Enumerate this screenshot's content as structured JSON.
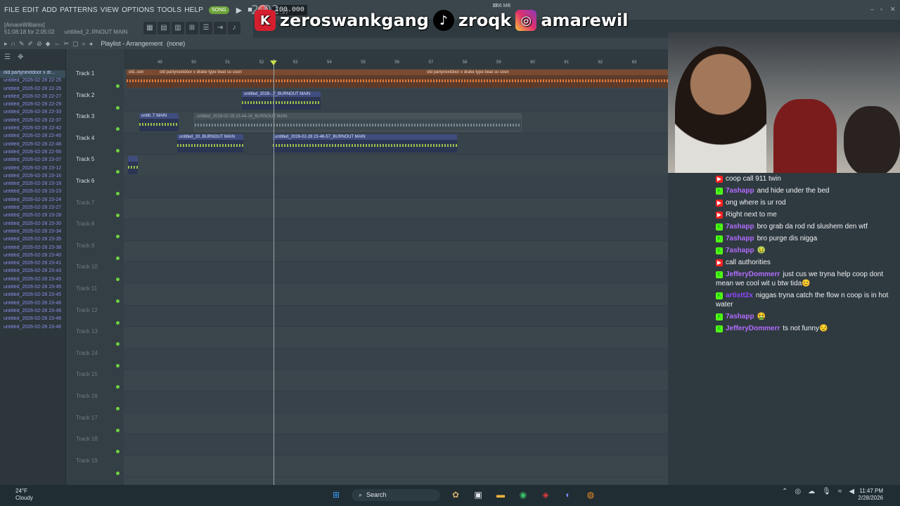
{
  "menubar": {
    "items": [
      "FILE",
      "EDIT",
      "ADD",
      "PATTERNS",
      "VIEW",
      "OPTIONS",
      "TOOLS",
      "HELP"
    ],
    "song_label": "SONG",
    "tempo": "100.000",
    "time_display": "2:02",
    "time_small": ":37",
    "memory": "666 MB",
    "pattern_num": "17",
    "project_name": "untitled_2..RNOUT MAIN",
    "hint_user": "[AmareWilliams]",
    "hint_time": "51:08:18 for 2:05:02"
  },
  "overlay": {
    "handle1": "zeroswankgang",
    "handle2": "zroqk",
    "handle3": "amarewil"
  },
  "playlist": {
    "title": "Playlist - Arrangement",
    "subtitle": "(none)"
  },
  "browser": {
    "items": [
      "old partynextdoor x dr...",
      "untitled_2026-02-28 22-25",
      "untitled_2026-02-28 22-26",
      "untitled_2026-02-28 22-27",
      "untitled_2026-02-28 22-29",
      "untitled_2026-02-28 22-33",
      "untitled_2026-02-28 22-37",
      "untitled_2026-02-28 22-42",
      "untitled_2026-02-28 22-45",
      "untitled_2026-02-28 22-48",
      "untitled_2026-02-28 22-56",
      "untitled_2026-02-28 23-07",
      "untitled_2026-02-28 23-12",
      "untitled_2026-02-28 23-16",
      "untitled_2026-02-28 23-18",
      "untitled_2026-02-28 23-23",
      "untitled_2026-02-28 23-24",
      "untitled_2026-02-28 23-27",
      "untitled_2026-02-28 23-28",
      "untitled_2026-02-28 23-30",
      "untitled_2026-02-28 23-34",
      "untitled_2026-02-28 23-35",
      "untitled_2026-02-28 23-38",
      "untitled_2026-02-28 23-40",
      "untitled_2026-02-28 23-41",
      "untitled_2026-02-28 23-43",
      "untitled_2026-02-28 23-45",
      "untitled_2026-02-28 23-45",
      "untitled_2026-02-28 23-45",
      "untitled_2026-02-28 23-46",
      "untitled_2026-02-28 23-46",
      "untitled_2026-02-28 23-46",
      "untitled_2026-02-28 23-46"
    ]
  },
  "tracks": [
    "Track 1",
    "Track 2",
    "Track 3",
    "Track 4",
    "Track 5",
    "Track 6",
    "Track 7",
    "Track 8",
    "Track 9",
    "Track 10",
    "Track 11",
    "Track 12",
    "Track 13",
    "Track 14",
    "Track 15",
    "Track 16",
    "Track 17",
    "Track 18",
    "Track 19"
  ],
  "ruler": [
    "49",
    "50",
    "51",
    "52",
    "53",
    "54",
    "55",
    "56",
    "57",
    "58",
    "59",
    "60",
    "61",
    "62",
    "63"
  ],
  "clips": {
    "t1a": "old..oon",
    "t1b": "old partynextdoor x drake type beat so soon",
    "t1c": "old partynextdoor x drake type beat so soon",
    "t2": "untitled_2026-..7_BURNOUT MAIN",
    "t3a": "untitl..T MAIN",
    "t3b": "untitled_2026-02-28 23-44-16_BURNOUT MAIN",
    "t4a": "untitled_20..BURNOUT MAIN",
    "t4b": "untitled_2026-02-28 23-46-57_BURNOUT MAIN"
  },
  "chat": [
    {
      "platform": "yt",
      "user": "",
      "text": "coop call 911 twin",
      "color": "#9146ff"
    },
    {
      "platform": "kick",
      "user": "7ashapp",
      "text": "and hide under the bed",
      "color": "#b36cff"
    },
    {
      "platform": "yt",
      "user": "",
      "text": "ong where is ur rod",
      "color": "#9146ff"
    },
    {
      "platform": "yt",
      "user": "",
      "text": "Right next to me",
      "color": "#c93a3a"
    },
    {
      "platform": "kick",
      "user": "7ashapp",
      "text": "bro grab da rod nd slushem den wtf",
      "color": "#b36cff"
    },
    {
      "platform": "kick",
      "user": "7ashapp",
      "text": "bro purge dis nigga",
      "color": "#b36cff"
    },
    {
      "platform": "kick",
      "user": "7ashapp",
      "text": "🤢",
      "color": "#b36cff"
    },
    {
      "platform": "yt",
      "user": "",
      "text": "call authorities",
      "color": "#9146ff"
    },
    {
      "platform": "kick",
      "user": "JefferyDommerr",
      "text": "just cus we tryna help coop dont mean we cool wit u btw tida😊",
      "color": "#b36cff"
    },
    {
      "platform": "kick",
      "user": "artistt2x",
      "text": "niggas tryna catch the flow n coop is in hot water",
      "color": "#9146ff"
    },
    {
      "platform": "kick",
      "user": "7ashapp",
      "text": "🤮",
      "color": "#b36cff"
    },
    {
      "platform": "kick",
      "user": "JefferyDommerr",
      "text": "ts not funny😒",
      "color": "#b36cff"
    }
  ],
  "taskbar": {
    "weather_temp": "24°F",
    "weather_desc": "Cloudy",
    "search_placeholder": "Search",
    "time": "11:47 PM",
    "date": "2/28/2026"
  }
}
